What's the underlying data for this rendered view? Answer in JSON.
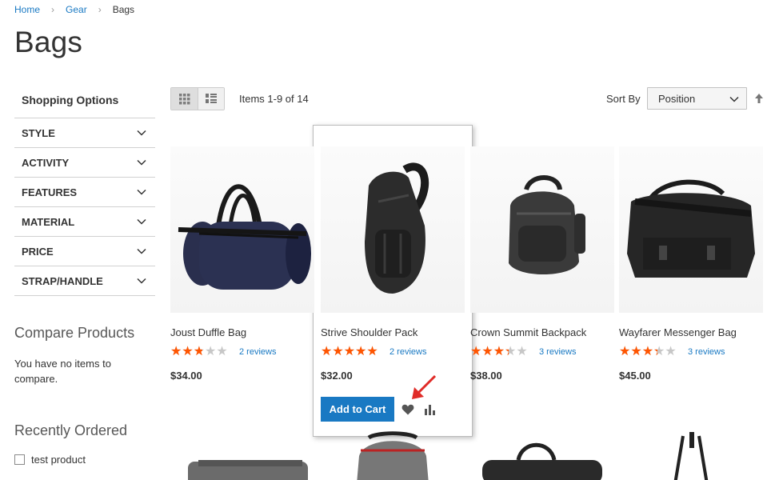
{
  "breadcrumb": {
    "home": "Home",
    "gear": "Gear",
    "current": "Bags"
  },
  "page": {
    "title": "Bags"
  },
  "sidebar": {
    "title": "Shopping Options",
    "filters": [
      "STYLE",
      "ACTIVITY",
      "FEATURES",
      "MATERIAL",
      "PRICE",
      "STRAP/HANDLE"
    ]
  },
  "compare": {
    "title": "Compare Products",
    "empty": "You have no items to compare."
  },
  "recent": {
    "title": "Recently Ordered",
    "item": "test product"
  },
  "toolbar": {
    "amount": "Items 1-9 of 14",
    "sort_label": "Sort By",
    "sort_value": "Position"
  },
  "products": [
    {
      "name": "Joust Duffle Bag",
      "reviews": "2 reviews",
      "price": "$34.00",
      "rating": 0.5
    },
    {
      "name": "Strive Shoulder Pack",
      "reviews": "2 reviews",
      "price": "$32.00",
      "rating": 0.9
    },
    {
      "name": "Crown Summit Backpack",
      "reviews": "3 reviews",
      "price": "$38.00",
      "rating": 0.6
    },
    {
      "name": "Wayfarer Messenger Bag",
      "reviews": "3 reviews",
      "price": "$45.00",
      "rating": 0.6
    }
  ],
  "actions": {
    "add_to_cart": "Add to Cart"
  },
  "colors": {
    "link": "#1979c3",
    "star": "#ff5501",
    "button": "#1979c3",
    "arrow": "#e02b27"
  }
}
